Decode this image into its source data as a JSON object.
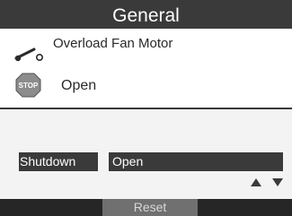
{
  "header": {
    "title": "General"
  },
  "alarm": {
    "name": "Overload Fan Motor",
    "state": "Open",
    "contact_icon": "switch-contact-icon",
    "stop_icon": "stop-sign-icon",
    "stop_icon_text": "STOP"
  },
  "field": {
    "label": "Shutdown",
    "value": "Open"
  },
  "navigation": {
    "up_icon": "arrow-up-icon",
    "down_icon": "arrow-down-icon"
  },
  "footer": {
    "reset_label": "Reset"
  },
  "colors": {
    "header_background": "#3a3a3a",
    "field_background": "#3a3a3a",
    "footer_background": "#262626",
    "reset_background": "#707070",
    "stop_red": "#8c8c8c",
    "text_light": "#ffffff"
  }
}
